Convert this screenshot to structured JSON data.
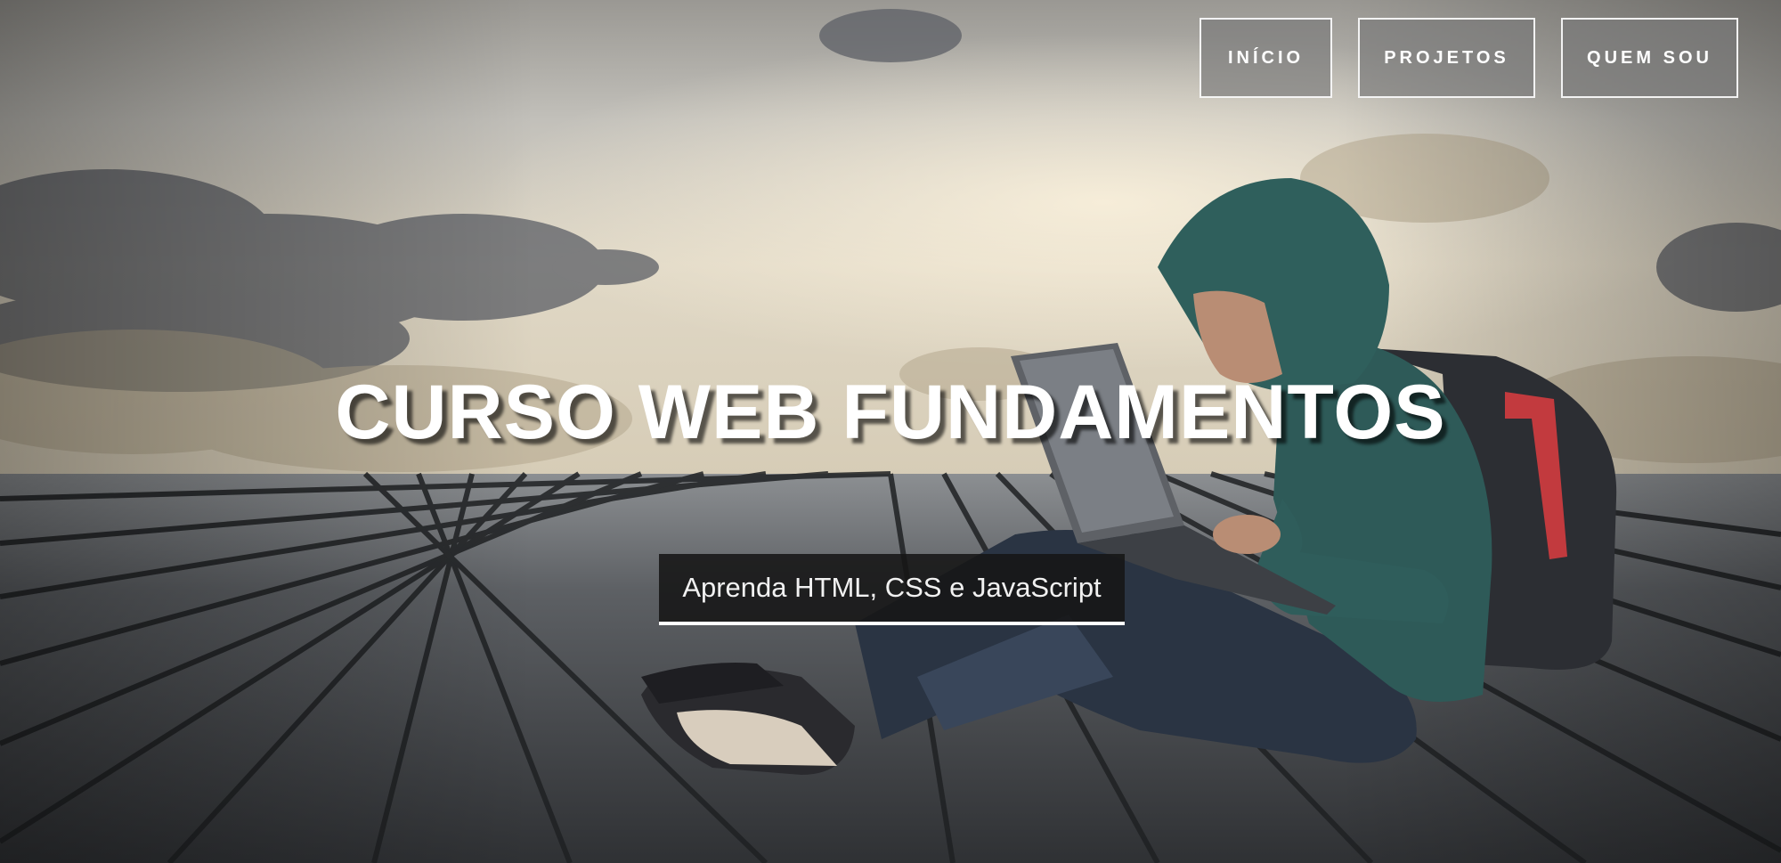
{
  "nav": {
    "items": [
      {
        "label": "INÍCIO"
      },
      {
        "label": "PROJETOS"
      },
      {
        "label": "QUEM SOU"
      }
    ]
  },
  "hero": {
    "title": "CURSO WEB FUNDAMENTOS",
    "subtitle": "Aprenda HTML, CSS e JavaScript"
  },
  "colors": {
    "nav_border": "#ffffff",
    "nav_background": "#787878",
    "subtitle_background": "#161616",
    "deck": "#4a4d50",
    "sky": "#cfcac0",
    "hoodie": "#2e5a58",
    "backpack_accent": "#c23a3e"
  },
  "icons": []
}
